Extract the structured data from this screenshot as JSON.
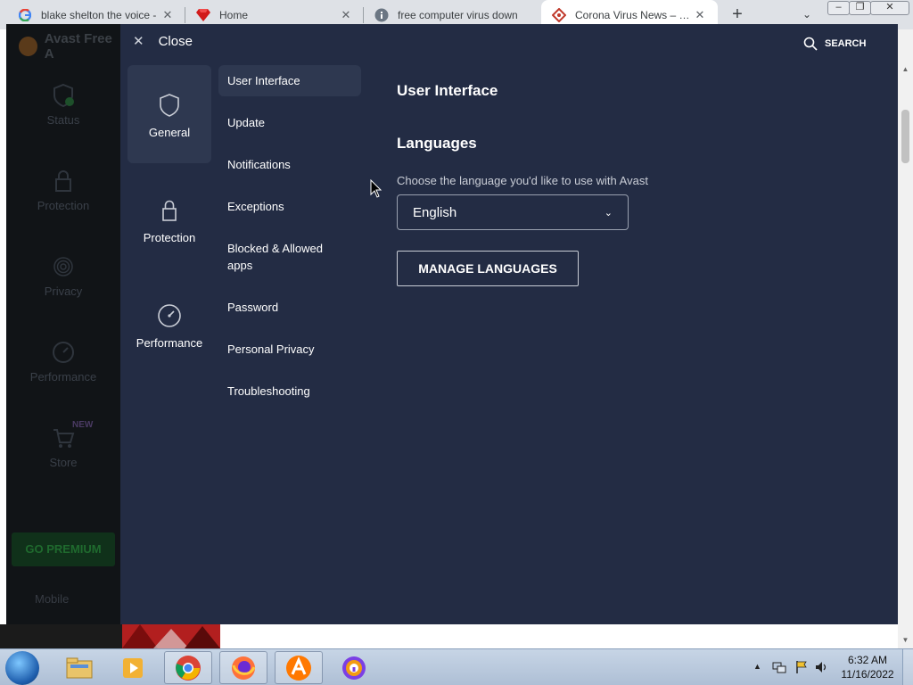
{
  "browser": {
    "tabs": [
      {
        "title": "blake shelton the voice -",
        "icon": "google-icon"
      },
      {
        "title": "Home",
        "icon": "ruby-gem-icon"
      },
      {
        "title": "free computer virus down",
        "icon": "info-icon"
      },
      {
        "title": "Corona Virus News – Cor",
        "icon": "news-diamond-icon",
        "active": true
      }
    ],
    "new_tab": "+",
    "close_glyph": "✕"
  },
  "avast": {
    "app_title": "Avast Free A",
    "sidebar": [
      {
        "label": "Status",
        "icon": "shield-check-icon"
      },
      {
        "label": "Protection",
        "icon": "lock-icon"
      },
      {
        "label": "Privacy",
        "icon": "fingerprint-icon"
      },
      {
        "label": "Performance",
        "icon": "speedometer-icon"
      },
      {
        "label": "Store",
        "icon": "cart-icon"
      }
    ],
    "new_badge": "NEW",
    "go_premium": "GO PREMIUM",
    "mobile": "Mobile",
    "settings": {
      "close_label": "Close",
      "search_label": "SEARCH",
      "categories": [
        {
          "label": "General",
          "icon": "shield-icon",
          "active": true
        },
        {
          "label": "Protection",
          "icon": "lock-icon"
        },
        {
          "label": "Performance",
          "icon": "speedometer-icon"
        }
      ],
      "subsections": [
        {
          "label": "User Interface",
          "active": true
        },
        {
          "label": "Update"
        },
        {
          "label": "Notifications"
        },
        {
          "label": "Exceptions"
        },
        {
          "label": "Blocked & Allowed apps"
        },
        {
          "label": "Password"
        },
        {
          "label": "Personal Privacy"
        },
        {
          "label": "Troubleshooting"
        }
      ],
      "content": {
        "title": "User Interface",
        "languages_heading": "Languages",
        "languages_description": "Choose the language you'd like to use with Avast",
        "language_selected": "English",
        "manage_button": "MANAGE LANGUAGES"
      }
    }
  },
  "taskbar": {
    "apps": [
      "explorer-icon",
      "media-player-icon",
      "chrome-icon",
      "firefox-icon",
      "avast-icon",
      "avast-secure-browser-icon"
    ],
    "clock_time": "6:32 AM",
    "clock_date": "11/16/2022"
  }
}
